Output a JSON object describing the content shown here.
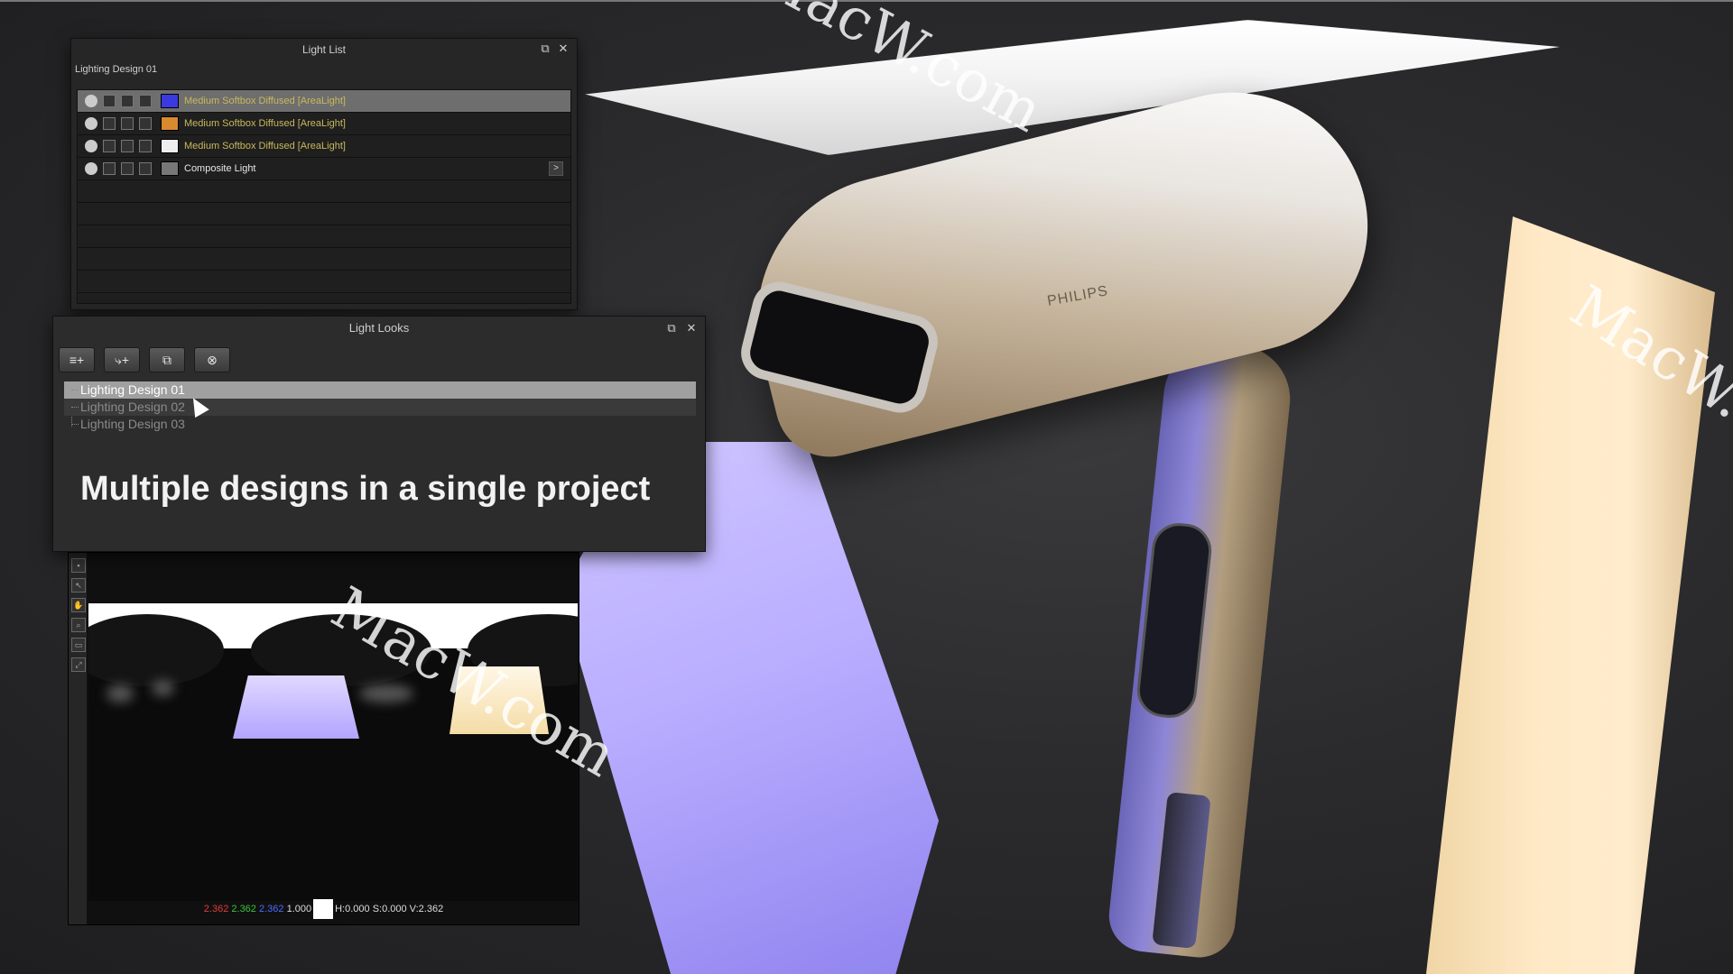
{
  "light_list": {
    "title": "Light List",
    "subtitle": "Lighting Design 01",
    "rows": [
      {
        "label": "Medium Softbox Diffused [AreaLight]",
        "swatch": "#3a3ae0"
      },
      {
        "label": "Medium Softbox Diffused [AreaLight]",
        "swatch": "#d9892e"
      },
      {
        "label": "Medium Softbox Diffused [AreaLight]",
        "swatch": "#eeeeee"
      },
      {
        "label": "Composite Light",
        "swatch": "#777777"
      }
    ]
  },
  "light_looks": {
    "title": "Light Looks",
    "items": [
      "Lighting Design 01",
      "Lighting Design 02",
      "Lighting Design 03"
    ],
    "selected_index": 0
  },
  "caption": "Multiple designs in a single project",
  "viewer": {
    "r": "2.362",
    "g": "2.362",
    "b": "2.362",
    "alpha": "1.000",
    "hsv": "H:0.000 S:0.000 V:2.362"
  },
  "scene": {
    "brand": "PHILIPS",
    "watermark": "MacW.com"
  },
  "colors": {
    "accent_purple": "#b9adff",
    "accent_warm": "#ffe9c7"
  }
}
